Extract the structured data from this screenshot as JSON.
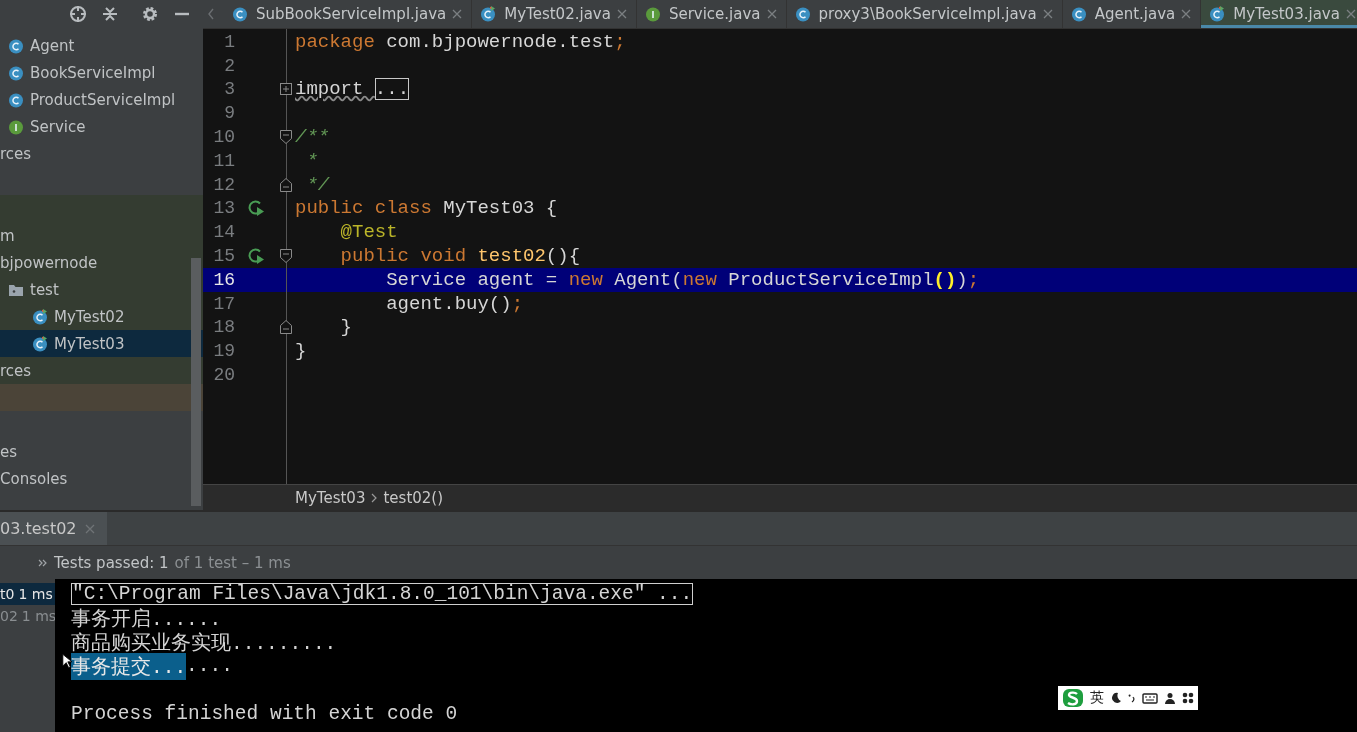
{
  "toolbar": {
    "icons": [
      {
        "kind": "locate"
      },
      {
        "kind": "collapse"
      },
      {
        "kind": "settings"
      },
      {
        "kind": "hide"
      }
    ]
  },
  "tabs": [
    {
      "label": "SubBookServiceImpl.java",
      "kind": "class",
      "selected": false
    },
    {
      "label": "MyTest02.java",
      "kind": "test",
      "selected": false
    },
    {
      "label": "Service.java",
      "kind": "interface",
      "selected": false
    },
    {
      "label": "proxy3\\BookServiceImpl.java",
      "kind": "class",
      "selected": false
    },
    {
      "label": "Agent.java",
      "kind": "class",
      "selected": false
    },
    {
      "label": "MyTest03.java",
      "kind": "test",
      "selected": true
    }
  ],
  "project_tree": [
    {
      "kind": "sources",
      "items": [
        {
          "label": "Agent",
          "kind": "class",
          "selected": false
        },
        {
          "label": "BookServiceImpl",
          "kind": "class",
          "selected": false
        },
        {
          "label": "ProductServiceImpl",
          "kind": "class",
          "selected": false
        },
        {
          "label": "Service",
          "kind": "interface",
          "selected": false
        },
        {
          "label": "rces",
          "kind": "plain",
          "selected": false
        }
      ]
    },
    {
      "kind": "test-module",
      "items": [
        {
          "label": "m",
          "kind": "plain",
          "selected": false
        },
        {
          "label": "bjpowernode",
          "kind": "plain",
          "selected": false,
          "children": [
            {
              "label": "test",
              "kind": "folder",
              "selected": false,
              "children": [
                {
                  "label": "MyTest02",
                  "kind": "test",
                  "selected": false
                },
                {
                  "label": "MyTest03",
                  "kind": "test",
                  "selected": true
                }
              ]
            }
          ]
        },
        {
          "label": "rces",
          "kind": "plain",
          "selected": false
        }
      ]
    },
    {
      "kind": "excluded"
    },
    {
      "kind": "other",
      "items": [
        {
          "label": "es",
          "kind": "plain",
          "selected": false
        },
        {
          "label": "Consoles",
          "kind": "plain",
          "selected": false
        }
      ]
    }
  ],
  "editor": {
    "lines": [
      {
        "number": "1",
        "tokens": [
          {
            "text": "package ",
            "kind": "keyword"
          },
          {
            "text": "com.bjpowernode.test",
            "kind": "plain"
          },
          {
            "text": ";",
            "kind": "punct"
          }
        ]
      },
      {
        "number": "2"
      },
      {
        "number": "3",
        "folded": true,
        "tokens": [
          {
            "text": "import ",
            "kind": "warning"
          },
          {
            "text": "...",
            "kind": "folded"
          }
        ]
      },
      {
        "number": "9"
      },
      {
        "number": "10",
        "fold_start": true,
        "tokens": [
          {
            "text": "/**",
            "kind": "doc"
          }
        ]
      },
      {
        "number": "11",
        "tokens": [
          {
            "text": " *",
            "kind": "doc"
          }
        ]
      },
      {
        "number": "12",
        "fold_end": true,
        "tokens": [
          {
            "text": " */",
            "kind": "doc"
          }
        ]
      },
      {
        "number": "13",
        "run": true,
        "tokens": [
          {
            "text": "public class ",
            "kind": "keyword"
          },
          {
            "text": "MyTest03 {",
            "kind": "plain"
          }
        ]
      },
      {
        "number": "14",
        "tokens": [
          {
            "text": "    @Test",
            "kind": "annotation"
          }
        ]
      },
      {
        "number": "15",
        "run": true,
        "fold_start": true,
        "tokens": [
          {
            "text": "    public void ",
            "kind": "keyword"
          },
          {
            "text": "test02",
            "kind": "method"
          },
          {
            "text": "(){",
            "kind": "plain"
          }
        ]
      },
      {
        "number": "16",
        "highlighted": true,
        "tokens": [
          {
            "text": "        Service agent = ",
            "kind": "plain"
          },
          {
            "text": "new ",
            "kind": "keyword"
          },
          {
            "text": "Agent(",
            "kind": "plain"
          },
          {
            "text": "new ",
            "kind": "keyword"
          },
          {
            "text": "ProductServiceImpl",
            "kind": "plain"
          },
          {
            "text": "()",
            "kind": "brace"
          },
          {
            "text": ")",
            "kind": "plain"
          },
          {
            "text": ";",
            "kind": "punct"
          }
        ]
      },
      {
        "number": "17",
        "tokens": [
          {
            "text": "        agent.buy()",
            "kind": "plain"
          },
          {
            "text": ";",
            "kind": "punct"
          }
        ]
      },
      {
        "number": "18",
        "fold_end": true,
        "tokens": [
          {
            "text": "    }",
            "kind": "plain"
          }
        ]
      },
      {
        "number": "19",
        "tokens": [
          {
            "text": "}",
            "kind": "plain"
          }
        ]
      },
      {
        "number": "20"
      }
    ]
  },
  "breadcrumb": [
    "MyTest03",
    "test02()"
  ],
  "run_tab": {
    "label": "03.test02"
  },
  "test_status": {
    "summary": "Tests passed: 1",
    "detail": "of 1 test – 1 ms"
  },
  "test_results": [
    {
      "name": "t0",
      "time": "1 ms",
      "selected": true
    },
    {
      "name": "02",
      "time": "1 ms",
      "selected": false
    }
  ],
  "console": [
    {
      "kind": "command",
      "segments": [
        {
          "text": "\"C:\\Program Files\\Java\\jdk1.8.0_101\\bin\\java.exe\" ...",
          "selected": false
        }
      ]
    },
    {
      "kind": "output",
      "segments": [
        {
          "text": "事务开启......",
          "selected": false
        }
      ]
    },
    {
      "kind": "output",
      "segments": [
        {
          "text": "商品购买业务实现.........",
          "selected": false
        }
      ]
    },
    {
      "kind": "output",
      "segments": [
        {
          "text": "事务提交...",
          "selected": true
        },
        {
          "text": "....",
          "selected": false
        }
      ]
    },
    {
      "kind": "exit",
      "segments": [
        {
          "text": "Process finished with exit code 0",
          "selected": false
        }
      ]
    }
  ],
  "ime_toolbar": {
    "mode": "英"
  }
}
